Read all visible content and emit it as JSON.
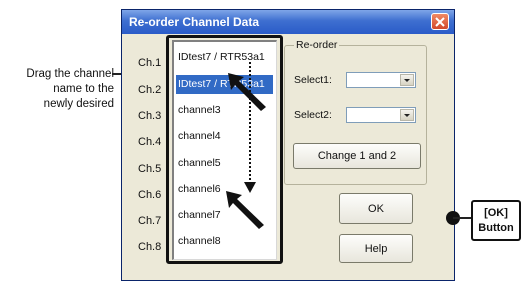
{
  "window": {
    "title": "Re-order Channel Data"
  },
  "channel_labels": [
    "Ch.1",
    "Ch.2",
    "Ch.3",
    "Ch.4",
    "Ch.5",
    "Ch.6",
    "Ch.7",
    "Ch.8"
  ],
  "channel_list": [
    "IDtest7 / RTR53a1",
    "IDtest7 / RTR53a1",
    "channel3",
    "channel4",
    "channel5",
    "channel6",
    "channel7",
    "channel8"
  ],
  "selected_index": 1,
  "reorder": {
    "legend": "Re-order",
    "select1_label": "Select1:",
    "select1_value": "",
    "select2_label": "Select2:",
    "select2_value": "",
    "change_button": "Change 1 and 2"
  },
  "buttons": {
    "ok": "OK",
    "help": "Help"
  },
  "annotations": {
    "drag_note": [
      "Drag the channel",
      "name to the",
      "newly desired"
    ],
    "ok_callout": [
      "[OK]",
      "Button"
    ]
  },
  "colors": {
    "title_bar": "#2a5bc8",
    "selection": "#316ac5",
    "dialog_bg": "#ece9d8",
    "close_button": "#d2482a"
  }
}
